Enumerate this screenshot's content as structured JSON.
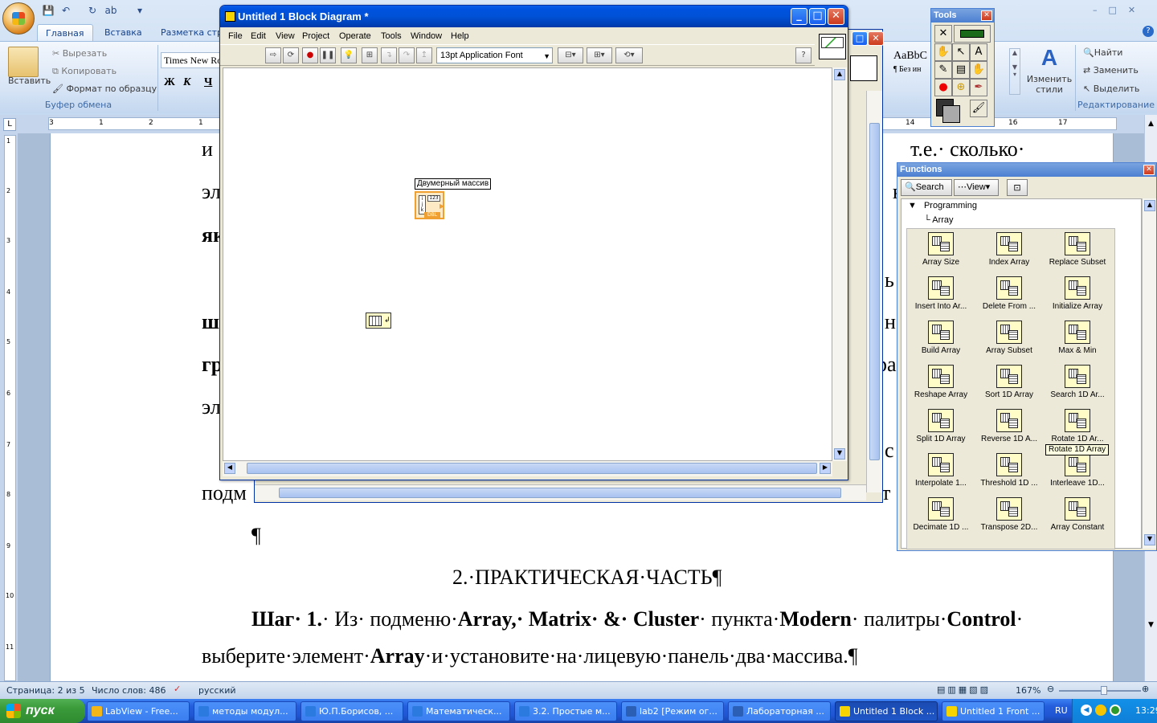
{
  "word": {
    "tabs": [
      "Главная",
      "Вставка",
      "Разметка стра"
    ],
    "clipboard": {
      "paste": "Вставить",
      "cut": "Вырезать",
      "copy": "Копировать",
      "format": "Формат по образцу",
      "group": "Буфер обмена"
    },
    "font_box": "Times New Ro",
    "font_buttons": [
      "Ж",
      "К",
      "Ч"
    ],
    "styles": {
      "sample": "AaBbC",
      "normal": "¶ Без ин",
      "change": "Изменить",
      "change2": "стили"
    },
    "editing": {
      "find": "Найти",
      "replace": "Заменить",
      "select": "Выделить",
      "group": "Редактирование"
    },
    "ruler_left": [
      "3",
      "1",
      "2",
      "1"
    ],
    "ruler_right": [
      "14",
      "16",
      "17"
    ],
    "vruler": [
      "1",
      "2",
      "3",
      "4",
      "5",
      "6",
      "7",
      "8",
      "9",
      "10",
      "11"
    ],
    "doc": {
      "frag1": "и",
      "frag1r": "т.е.· сколько·",
      "frag2": "эл",
      "frag2r": "ю",
      "frag3": "як",
      "frag4r": "ь",
      "frag5": "ш",
      "frag5r": "н",
      "frag6": "гр",
      "frag6r": "ра",
      "frag7": "эл",
      "frag8r": "с",
      "frag9": "подм",
      "frag9r": "т",
      "para": "¶",
      "heading": "2.·ПРАКТИЧЕСКАЯ·ЧАСТЬ¶",
      "step_label": "Шаг· 1.",
      "step_t1": "· Из· подменю·",
      "step_b1": "Array,· Matrix· &· Cluster",
      "step_t2": "· пункта·",
      "step_b2": "Modern",
      "step_t3": "· палитры·",
      "step_b3": "Control",
      "step_t4": "·",
      "line2_t1": "выберите·элемент·",
      "line2_b1": "Array",
      "line2_t2": "·и·установите·на·лицевую·панель·два·массива.¶"
    },
    "status": {
      "page": "Страница: 2 из 5",
      "words": "Число слов: 486",
      "lang": "русский",
      "zoom": "167%"
    }
  },
  "block_diagram": {
    "title": "Untitled 1 Block Diagram *",
    "menu": [
      "File",
      "Edit",
      "View",
      "Project",
      "Operate",
      "Tools",
      "Window",
      "Help"
    ],
    "font": "13pt Application Font",
    "node_label": "Двумерный массив",
    "node_type": "123",
    "node_dbl": "DBL"
  },
  "tools": {
    "title": "Tools"
  },
  "functions": {
    "title": "Functions",
    "search": "Search",
    "view": "View",
    "tree_root": "Programming",
    "tree_child": "Array",
    "items": [
      "Array Size",
      "Index Array",
      "Replace Subset",
      "Insert Into Ar...",
      "Delete From ...",
      "Initialize Array",
      "Build Array",
      "Array Subset",
      "Max & Min",
      "Reshape Array",
      "Sort 1D Array",
      "Search 1D Ar...",
      "Split 1D Array",
      "Reverse 1D A...",
      "Rotate 1D Ar...",
      "Interpolate 1...",
      "Threshold 1D ...",
      "Interleave 1D...",
      "Decimate 1D ...",
      "Transpose 2D...",
      "Array Constant"
    ],
    "tooltip": "Rotate 1D Array"
  },
  "taskbar": {
    "start": "пуск",
    "tasks": [
      "LabView - Free...",
      "методы модул...",
      "Ю.П.Борисов, ...",
      "Математическ...",
      "3.2. Простые м...",
      "lab2 [Режим ог...",
      "Лабораторная ...",
      "Untitled 1 Block ...",
      "Untitled 1 Front ..."
    ],
    "lang": "RU",
    "time": "13:29"
  },
  "colors": {
    "accent": "#0054e3",
    "lv_node": "#f0a030",
    "fn_bg": "#fffcc8"
  }
}
